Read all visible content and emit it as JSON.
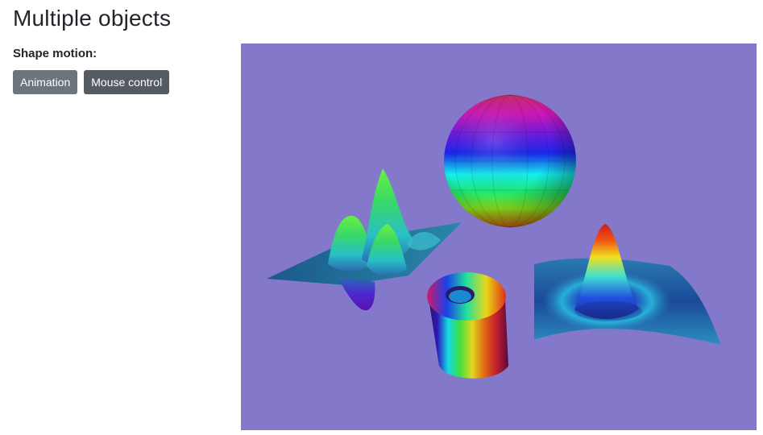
{
  "page": {
    "title": "Multiple objects"
  },
  "controls": {
    "label": "Shape motion:",
    "buttons": [
      {
        "label": "Animation"
      },
      {
        "label": "Mouse control"
      }
    ]
  },
  "scene": {
    "background_color": "#8378ca",
    "objects": [
      "sphere",
      "cylinder",
      "peaks-surface",
      "sinc-surface"
    ]
  }
}
